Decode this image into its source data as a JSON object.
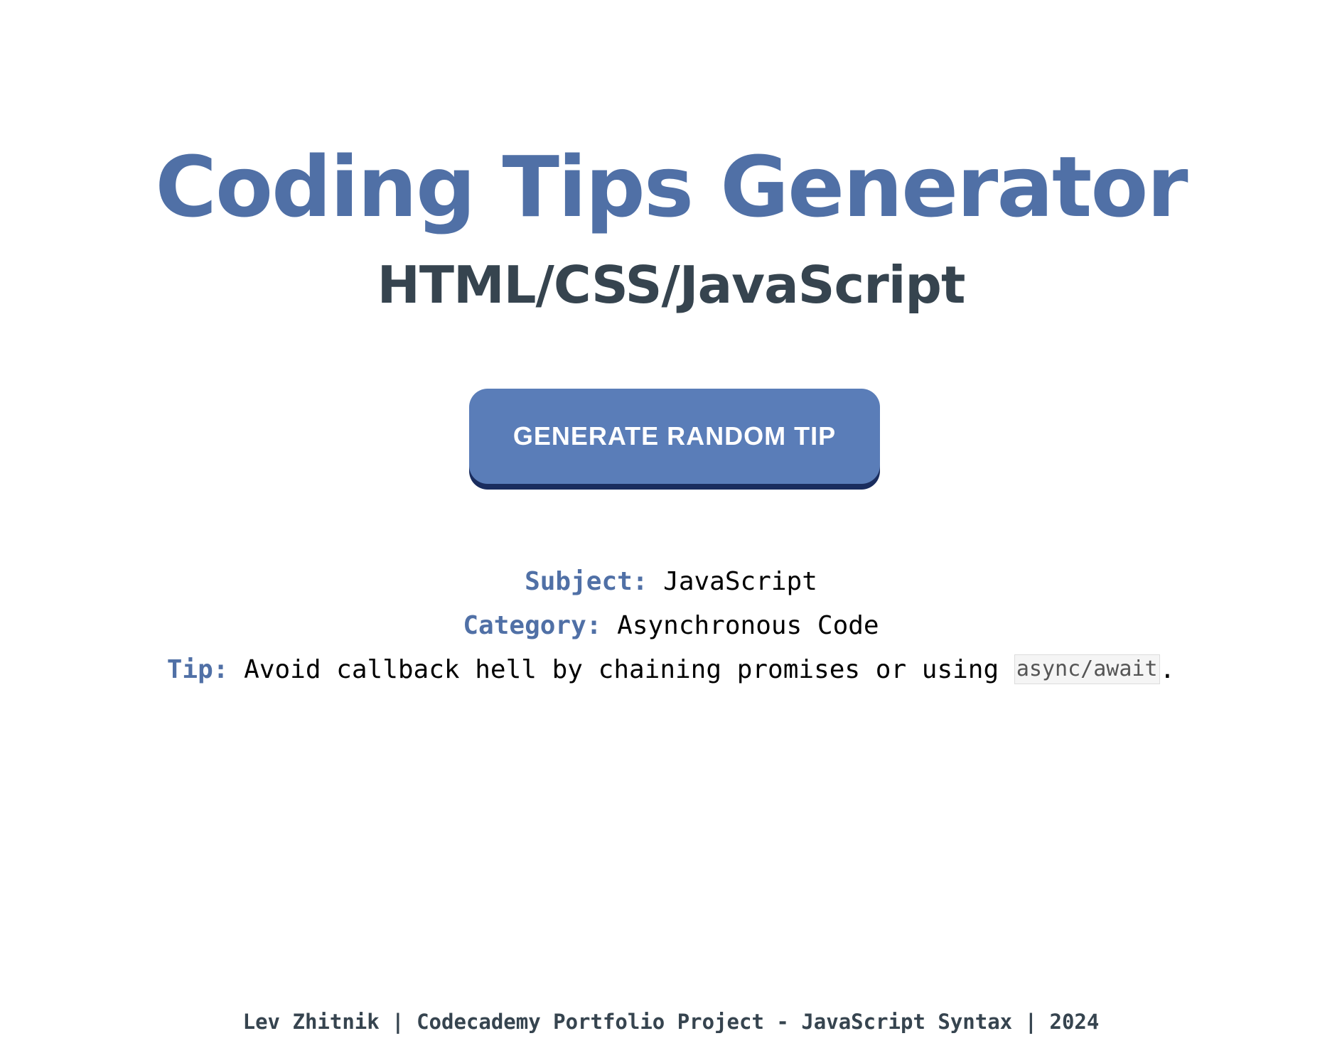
{
  "header": {
    "title": "Coding Tips Generator",
    "subtitle": "HTML/CSS/JavaScript"
  },
  "actions": {
    "generate_label": "GENERATE RANDOM TIP"
  },
  "tip": {
    "subject_label": "Subject:",
    "subject_value": "JavaScript",
    "category_label": "Category:",
    "category_value": "Asynchronous Code",
    "tip_label": "Tip:",
    "tip_text_before": "Avoid callback hell by chaining promises or using",
    "tip_code": "async/await",
    "tip_text_after": "."
  },
  "footer": {
    "text": "Lev Zhitnik | Codecademy Portfolio Project - JavaScript Syntax | 2024"
  },
  "colors": {
    "accent": "#5070a6",
    "button": "#5a7db8",
    "button_shadow": "#1a2d5e",
    "subtitle": "#36444f"
  }
}
